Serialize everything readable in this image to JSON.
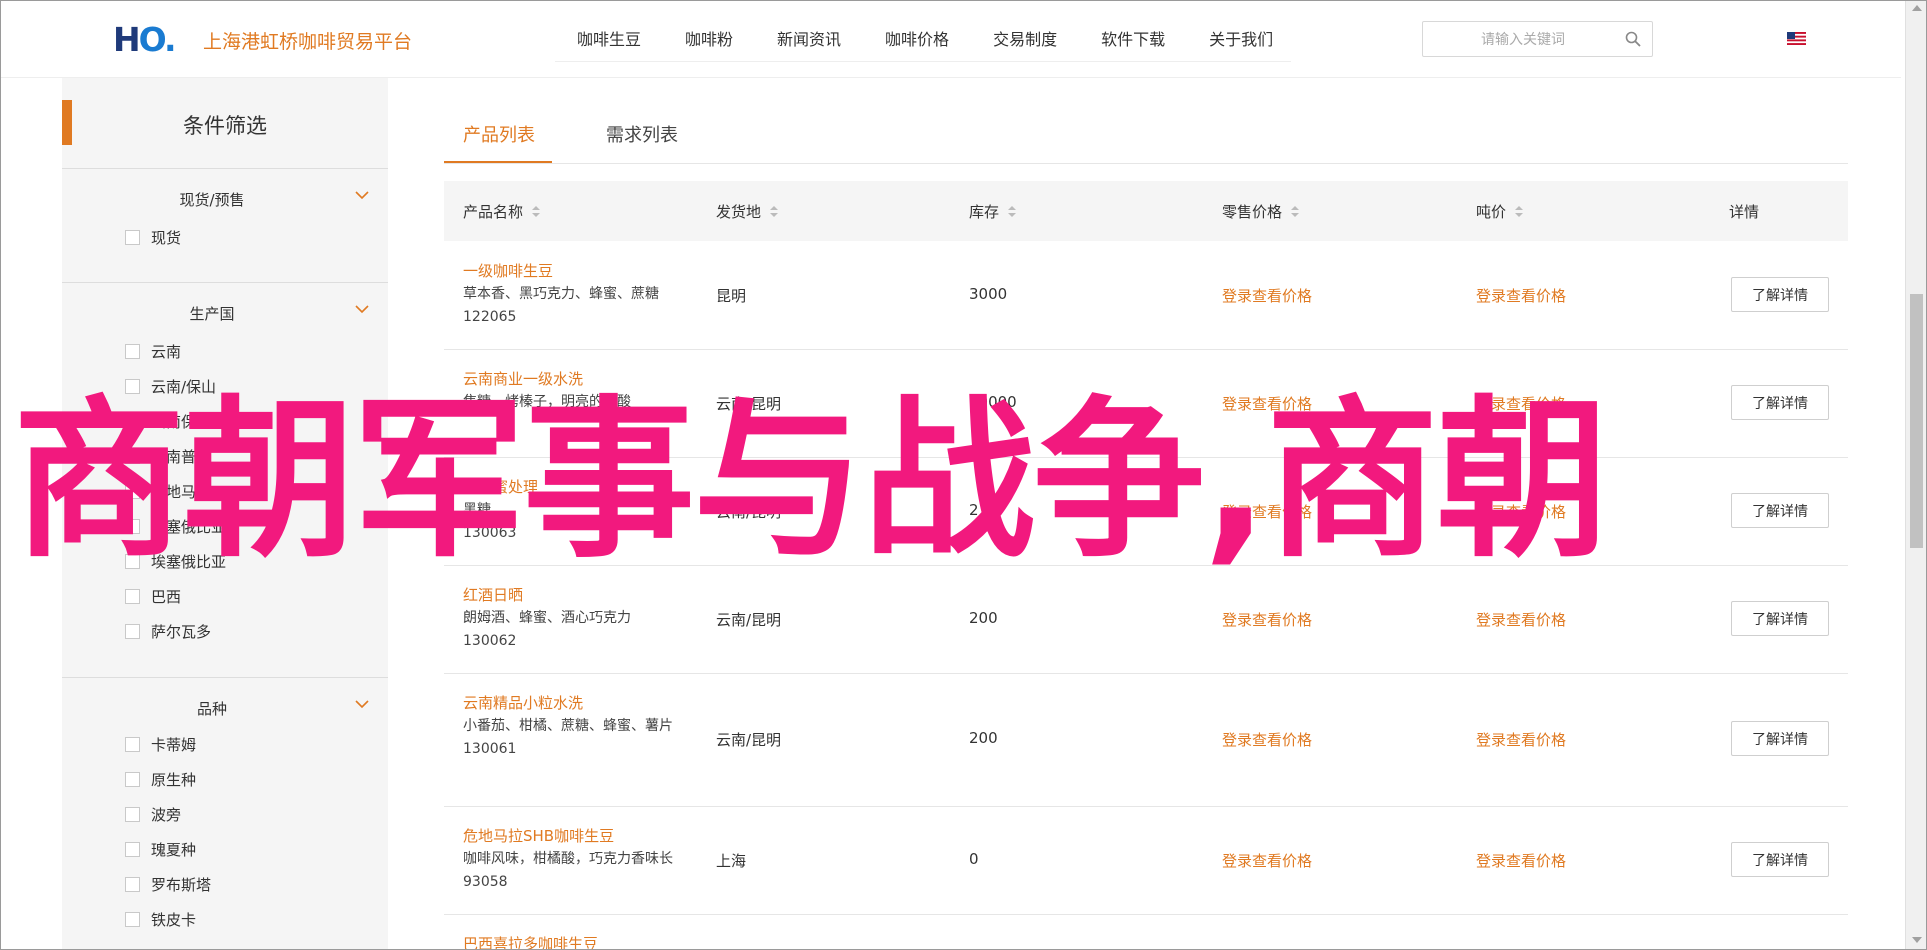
{
  "header": {
    "logo": "HO.",
    "brand": "上海港虹桥咖啡贸易平台",
    "nav": [
      "咖啡生豆",
      "咖啡粉",
      "新闻资讯",
      "咖啡价格",
      "交易制度",
      "软件下载",
      "关于我们"
    ],
    "search_placeholder": "请输入关键词",
    "search_icon": "search-icon",
    "language_flag": "us-flag-icon"
  },
  "sidebar": {
    "title": "条件筛选",
    "accent_color": "#e07a22",
    "groups": [
      {
        "title": "现货/预售",
        "options": [
          "现货"
        ]
      },
      {
        "title": "生产国",
        "options": [
          "云南",
          "云南/保山",
          "云南保山",
          "云南普洱",
          "危地马拉",
          "埃塞俄比亚",
          "埃塞俄比亚",
          "巴西",
          "萨尔瓦多"
        ]
      },
      {
        "title": "品种",
        "options": [
          "卡蒂姆",
          "原生种",
          "波旁",
          "瑰夏种",
          "罗布斯塔",
          "铁皮卡"
        ]
      }
    ]
  },
  "tabs": [
    "产品列表",
    "需求列表"
  ],
  "table": {
    "headers": [
      "产品名称",
      "发货地",
      "库存",
      "零售价格",
      "吨价",
      "详情"
    ],
    "rows": [
      {
        "name": "一级咖啡生豆",
        "desc": "草本香、黑巧克力、蜂蜜、蔗糖",
        "code": "122065",
        "origin": "昆明",
        "stock": "3000",
        "retail": "登录查看价格",
        "ton": "登录查看价格",
        "detail": "了解详情"
      },
      {
        "name": "云南商业一级水洗",
        "desc": "焦糖、烤榛子，明亮的果酸",
        "code": "",
        "origin": "云南/昆明",
        "stock": "30000",
        "retail": "登录查看价格",
        "ton": "登录查看价格",
        "detail": "了解详情"
      },
      {
        "name": "云南蜜处理",
        "desc": "黑糖",
        "code": "130063",
        "origin": "云南/昆明",
        "stock": "2",
        "retail": "登录查看价格",
        "ton": "登录查看价格",
        "detail": "了解详情"
      },
      {
        "name": "红酒日晒",
        "desc": "朗姆酒、蜂蜜、酒心巧克力",
        "code": "130062",
        "origin": "云南/昆明",
        "stock": "200",
        "retail": "登录查看价格",
        "ton": "登录查看价格",
        "detail": "了解详情"
      },
      {
        "name": "云南精品小粒水洗",
        "desc": "小番茄、柑橘、蔗糖、蜂蜜、薯片",
        "code": "130061",
        "origin": "云南/昆明",
        "stock": "200",
        "retail": "登录查看价格",
        "ton": "登录查看价格",
        "detail": "了解详情"
      },
      {
        "name": "危地马拉SHB咖啡生豆",
        "desc": "咖啡风味，柑橘酸，巧克力香味长",
        "code": "93058",
        "origin": "上海",
        "stock": "0",
        "retail": "登录查看价格",
        "ton": "登录查看价格",
        "detail": "了解详情"
      },
      {
        "name": "巴西喜拉多咖啡生豆",
        "desc": "",
        "code": "",
        "origin": "",
        "stock": "",
        "retail": "",
        "ton": "",
        "detail": ""
      }
    ]
  },
  "overlay": {
    "text": "商朝军事与战争,商朝",
    "color": "#f2197e"
  }
}
